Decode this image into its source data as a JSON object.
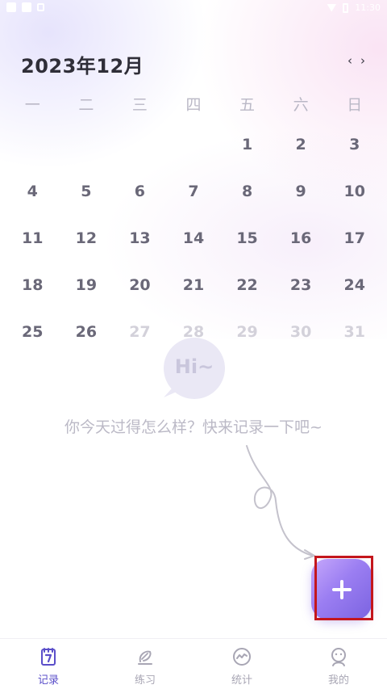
{
  "status_bar": {
    "time": "11:30"
  },
  "calendar": {
    "month_title": "2023年12月",
    "prev_arrow": "‹",
    "next_arrow": "›",
    "weekdays": [
      "一",
      "二",
      "三",
      "四",
      "五",
      "六",
      "日"
    ],
    "leading_blanks": 4,
    "days": [
      {
        "label": "1",
        "future": false
      },
      {
        "label": "2",
        "future": false
      },
      {
        "label": "3",
        "future": false
      },
      {
        "label": "4",
        "future": false
      },
      {
        "label": "5",
        "future": false
      },
      {
        "label": "6",
        "future": false
      },
      {
        "label": "7",
        "future": false
      },
      {
        "label": "8",
        "future": false
      },
      {
        "label": "9",
        "future": false
      },
      {
        "label": "10",
        "future": false
      },
      {
        "label": "11",
        "future": false
      },
      {
        "label": "12",
        "future": false
      },
      {
        "label": "13",
        "future": false
      },
      {
        "label": "14",
        "future": false
      },
      {
        "label": "15",
        "future": false
      },
      {
        "label": "16",
        "future": false
      },
      {
        "label": "17",
        "future": false
      },
      {
        "label": "18",
        "future": false
      },
      {
        "label": "19",
        "future": false
      },
      {
        "label": "20",
        "future": false
      },
      {
        "label": "21",
        "future": false
      },
      {
        "label": "22",
        "future": false
      },
      {
        "label": "23",
        "future": false
      },
      {
        "label": "24",
        "future": false
      },
      {
        "label": "25",
        "future": false
      },
      {
        "label": "26",
        "future": false
      },
      {
        "label": "27",
        "future": true
      },
      {
        "label": "28",
        "future": true
      },
      {
        "label": "29",
        "future": true
      },
      {
        "label": "30",
        "future": true
      },
      {
        "label": "31",
        "future": true
      }
    ]
  },
  "empty_state": {
    "bubble_text": "Hi~",
    "prompt": "你今天过得怎么样？快来记录一下吧~"
  },
  "add_button": {
    "icon": "plus-icon"
  },
  "tabs": [
    {
      "label": "记录",
      "icon": "notebook-icon",
      "active": true
    },
    {
      "label": "练习",
      "icon": "pen-icon",
      "active": false
    },
    {
      "label": "统计",
      "icon": "chart-icon",
      "active": false
    },
    {
      "label": "我的",
      "icon": "profile-icon",
      "active": false
    }
  ],
  "colors": {
    "accent": "#5a4ec9",
    "button_gradient_start": "#c6a8fb",
    "button_gradient_end": "#7b63e0",
    "future_day": "#d3d1da",
    "past_day": "#6a6878"
  }
}
